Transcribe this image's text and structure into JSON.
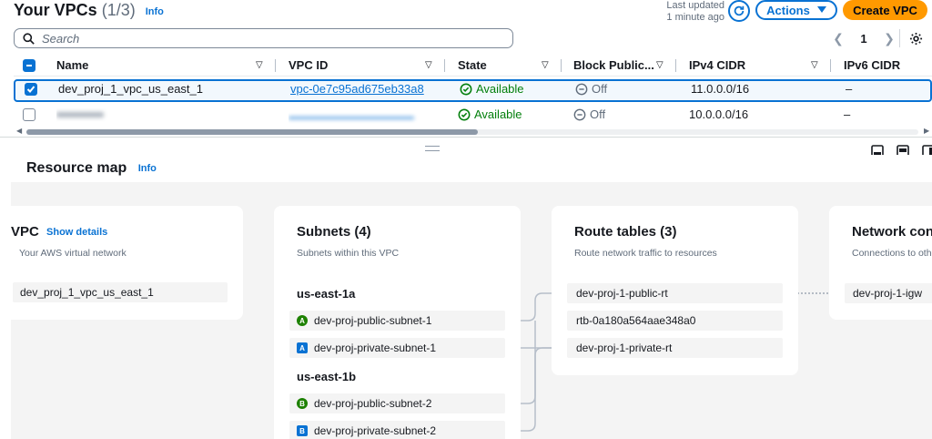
{
  "header": {
    "title": "Your VPCs",
    "count": "(1/3)",
    "info": "Info",
    "last_updated_line1": "Last updated",
    "last_updated_line2": "1 minute ago",
    "actions_label": "Actions",
    "create_label": "Create VPC"
  },
  "search": {
    "placeholder": "Search"
  },
  "pagination": {
    "current_page": "1"
  },
  "table": {
    "columns": [
      "Name",
      "VPC ID",
      "State",
      "Block Public...",
      "IPv4 CIDR",
      "IPv6 CIDR"
    ],
    "rows": [
      {
        "selected": true,
        "name": "dev_proj_1_vpc_us_east_1",
        "vpc_id": "vpc-0e7c95ad675eb33a8",
        "state": "Available",
        "block_public": "Off",
        "ipv4": "11.0.0.0/16",
        "ipv6": "–"
      },
      {
        "selected": false,
        "name": "",
        "vpc_id": "",
        "state": "Available",
        "block_public": "Off",
        "ipv4": "10.0.0.0/16",
        "ipv6": "–"
      }
    ]
  },
  "resource_map": {
    "title": "Resource map",
    "info": "Info",
    "vpc": {
      "title": "VPC",
      "show_details": "Show details",
      "subtitle": "Your AWS virtual network",
      "name": "dev_proj_1_vpc_us_east_1"
    },
    "subnets": {
      "title": "Subnets (4)",
      "subtitle": "Subnets within this VPC",
      "groups": [
        {
          "az": "us-east-1a",
          "items": [
            {
              "badge": "A",
              "type": "public",
              "name": "dev-proj-public-subnet-1"
            },
            {
              "badge": "A",
              "type": "private",
              "name": "dev-proj-private-subnet-1"
            }
          ]
        },
        {
          "az": "us-east-1b",
          "items": [
            {
              "badge": "B",
              "type": "public",
              "name": "dev-proj-public-subnet-2"
            },
            {
              "badge": "B",
              "type": "private",
              "name": "dev-proj-private-subnet-2"
            }
          ]
        }
      ]
    },
    "route_tables": {
      "title": "Route tables (3)",
      "subtitle": "Route network traffic to resources",
      "items": [
        "dev-proj-1-public-rt",
        "rtb-0a180a564aae348a0",
        "dev-proj-1-private-rt"
      ]
    },
    "network_connections": {
      "title": "Network connections",
      "subtitle": "Connections to other networks",
      "items": [
        "dev-proj-1-igw"
      ]
    }
  },
  "colors": {
    "accent": "#0972d3",
    "primary_button": "#ff9900",
    "status_available": "#037f0c",
    "public_badge": "#1d8102",
    "private_badge": "#0972d3"
  },
  "icons": [
    "refresh-icon",
    "caret-down-icon",
    "search-icon",
    "chevron-left-icon",
    "chevron-right-icon",
    "gear-icon",
    "sort-icon",
    "check-circle-icon",
    "off-circle-icon",
    "panel-bottom-icon",
    "panel-side-icon",
    "panel-right-icon"
  ]
}
